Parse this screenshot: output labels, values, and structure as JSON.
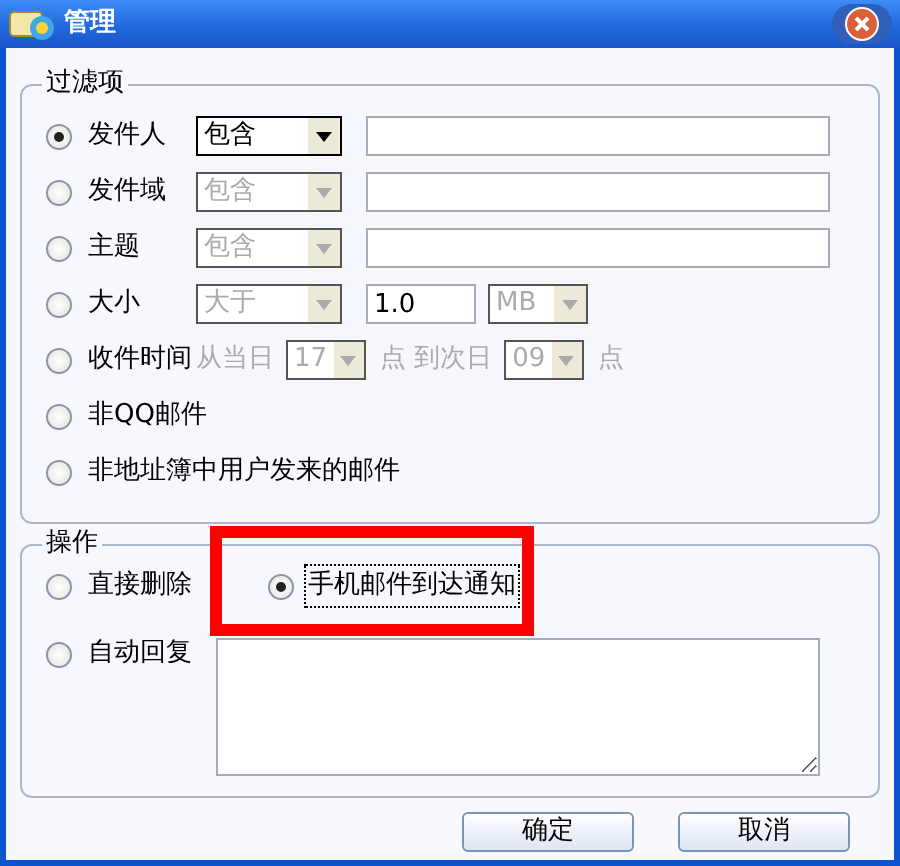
{
  "window": {
    "title": "管理"
  },
  "filter_group": {
    "legend": "过滤项",
    "rows": [
      {
        "label": "发件人",
        "selected": true,
        "parts": [
          {
            "kind": "combo",
            "value": "包含",
            "disabled": false
          },
          {
            "kind": "field"
          }
        ]
      },
      {
        "label": "发件域",
        "selected": false,
        "parts": [
          {
            "kind": "combo",
            "value": "包含",
            "disabled": true
          },
          {
            "kind": "field"
          }
        ]
      },
      {
        "label": "主题",
        "selected": false,
        "parts": [
          {
            "kind": "combo",
            "value": "包含",
            "disabled": true
          },
          {
            "kind": "field"
          }
        ]
      },
      {
        "label": "大小",
        "selected": false,
        "parts": [
          {
            "kind": "combo",
            "value": "大于",
            "disabled": true
          },
          {
            "kind": "short_field",
            "value": "1.0"
          },
          {
            "kind": "unit_combo",
            "value": "MB",
            "disabled": true
          }
        ]
      },
      {
        "label": "收件时间",
        "selected": false,
        "parts": [
          {
            "kind": "text",
            "text": "从当日"
          },
          {
            "kind": "small_combo",
            "value": "17",
            "disabled": true
          },
          {
            "kind": "text",
            "text": "点 到次日"
          },
          {
            "kind": "small_combo",
            "value": "09",
            "disabled": true
          },
          {
            "kind": "text",
            "text": "点"
          }
        ]
      },
      {
        "label": "非QQ邮件",
        "selected": false,
        "parts": []
      },
      {
        "label": "非地址簿中用户发来的邮件",
        "selected": false,
        "parts": []
      }
    ]
  },
  "action_group": {
    "legend": "操作",
    "options": [
      {
        "label": "直接删除",
        "selected": false
      },
      {
        "label": "自动回复",
        "selected": false
      }
    ],
    "notify": {
      "label": "手机邮件到达通知",
      "checked": true,
      "focused": true,
      "highlighted": true
    },
    "reply_box": {
      "disabled": false
    }
  },
  "buttons": [
    "确定",
    "取消"
  ]
}
